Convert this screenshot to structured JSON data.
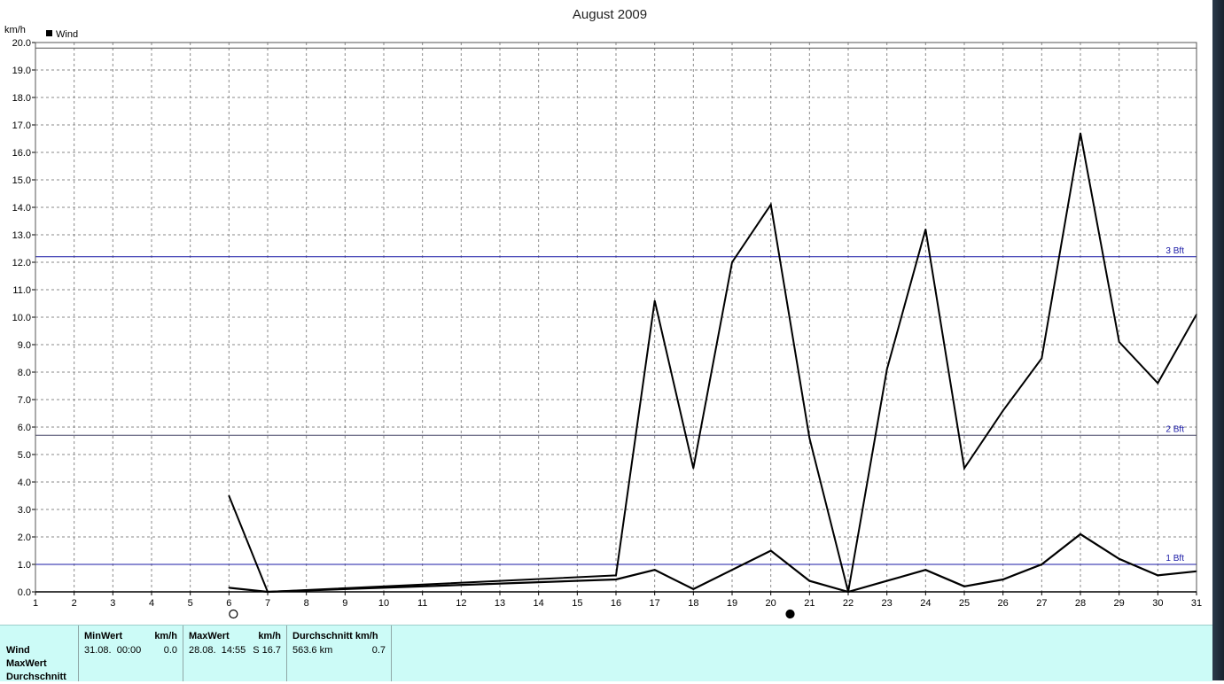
{
  "chart_data": {
    "type": "line",
    "title": "August 2009",
    "ylabel": "km/h",
    "xlabel": "",
    "x_ticks": [
      "1",
      "2",
      "3",
      "4",
      "5",
      "6",
      "7",
      "8",
      "9",
      "10",
      "11",
      "12",
      "13",
      "14",
      "15",
      "16",
      "17",
      "18",
      "19",
      "20",
      "21",
      "22",
      "23",
      "24",
      "25",
      "26",
      "27",
      "28",
      "29",
      "30",
      "31"
    ],
    "y_ticks": [
      "0.0",
      "1.0",
      "2.0",
      "3.0",
      "4.0",
      "5.0",
      "6.0",
      "7.0",
      "8.0",
      "9.0",
      "10.0",
      "11.0",
      "12.0",
      "13.0",
      "14.0",
      "15.0",
      "16.0",
      "17.0",
      "18.0",
      "19.0",
      "20.0"
    ],
    "xlim": [
      1,
      31
    ],
    "ylim": [
      0,
      20
    ],
    "grid": true,
    "legend": "top-left",
    "legend_entries": [
      "Wind"
    ],
    "series": [
      {
        "role": "max",
        "color": "#000000",
        "points": [
          [
            6,
            3.5
          ],
          [
            7,
            0.0
          ],
          [
            16,
            0.6
          ],
          [
            17,
            10.6
          ],
          [
            18,
            4.5
          ],
          [
            19,
            12.0
          ],
          [
            20,
            14.1
          ],
          [
            21,
            5.6
          ],
          [
            22,
            0.0
          ],
          [
            23,
            8.1
          ],
          [
            24,
            13.2
          ],
          [
            25,
            4.5
          ],
          [
            26,
            6.6
          ],
          [
            27,
            8.5
          ],
          [
            28,
            16.7
          ],
          [
            29,
            9.1
          ],
          [
            30,
            7.6
          ],
          [
            31,
            10.1
          ]
        ]
      },
      {
        "role": "average",
        "color": "#000000",
        "points": [
          [
            6,
            0.15
          ],
          [
            7,
            0.0
          ],
          [
            16,
            0.45
          ],
          [
            17,
            0.8
          ],
          [
            18,
            0.1
          ],
          [
            19,
            0.8
          ],
          [
            20,
            1.5
          ],
          [
            21,
            0.4
          ],
          [
            22,
            0.0
          ],
          [
            23,
            0.4
          ],
          [
            24,
            0.8
          ],
          [
            25,
            0.2
          ],
          [
            26,
            0.45
          ],
          [
            27,
            1.0
          ],
          [
            28,
            2.1
          ],
          [
            29,
            1.2
          ],
          [
            30,
            0.6
          ],
          [
            31,
            0.75
          ]
        ]
      }
    ],
    "reference_lines": [
      {
        "label": "1 Bft",
        "value": 1.0,
        "color": "#1a1aa6"
      },
      {
        "label": "2 Bft",
        "value": 5.7,
        "color": "#444466"
      },
      {
        "label": "3 Bft",
        "value": 12.2,
        "color": "#1a1aa6"
      },
      {
        "label": "",
        "value": 19.8,
        "color": "#555555"
      }
    ],
    "moon_phases": [
      {
        "day": 6,
        "phase": "full"
      },
      {
        "day": 20.5,
        "phase": "new"
      }
    ]
  },
  "stats": {
    "row_labels": [
      "Wind",
      "MaxWert",
      "Durchschnitt"
    ],
    "min": {
      "header": "MinWert",
      "unit": "km/h",
      "date": "31.08.  00:00",
      "value": "0.0"
    },
    "max": {
      "header": "MaxWert",
      "unit": "km/h",
      "date": "28.08.  14:55",
      "value": "S 16.7"
    },
    "avg": {
      "header": "Durchschnitt km/h",
      "distance": "563.6 km",
      "value": "0.7"
    }
  }
}
